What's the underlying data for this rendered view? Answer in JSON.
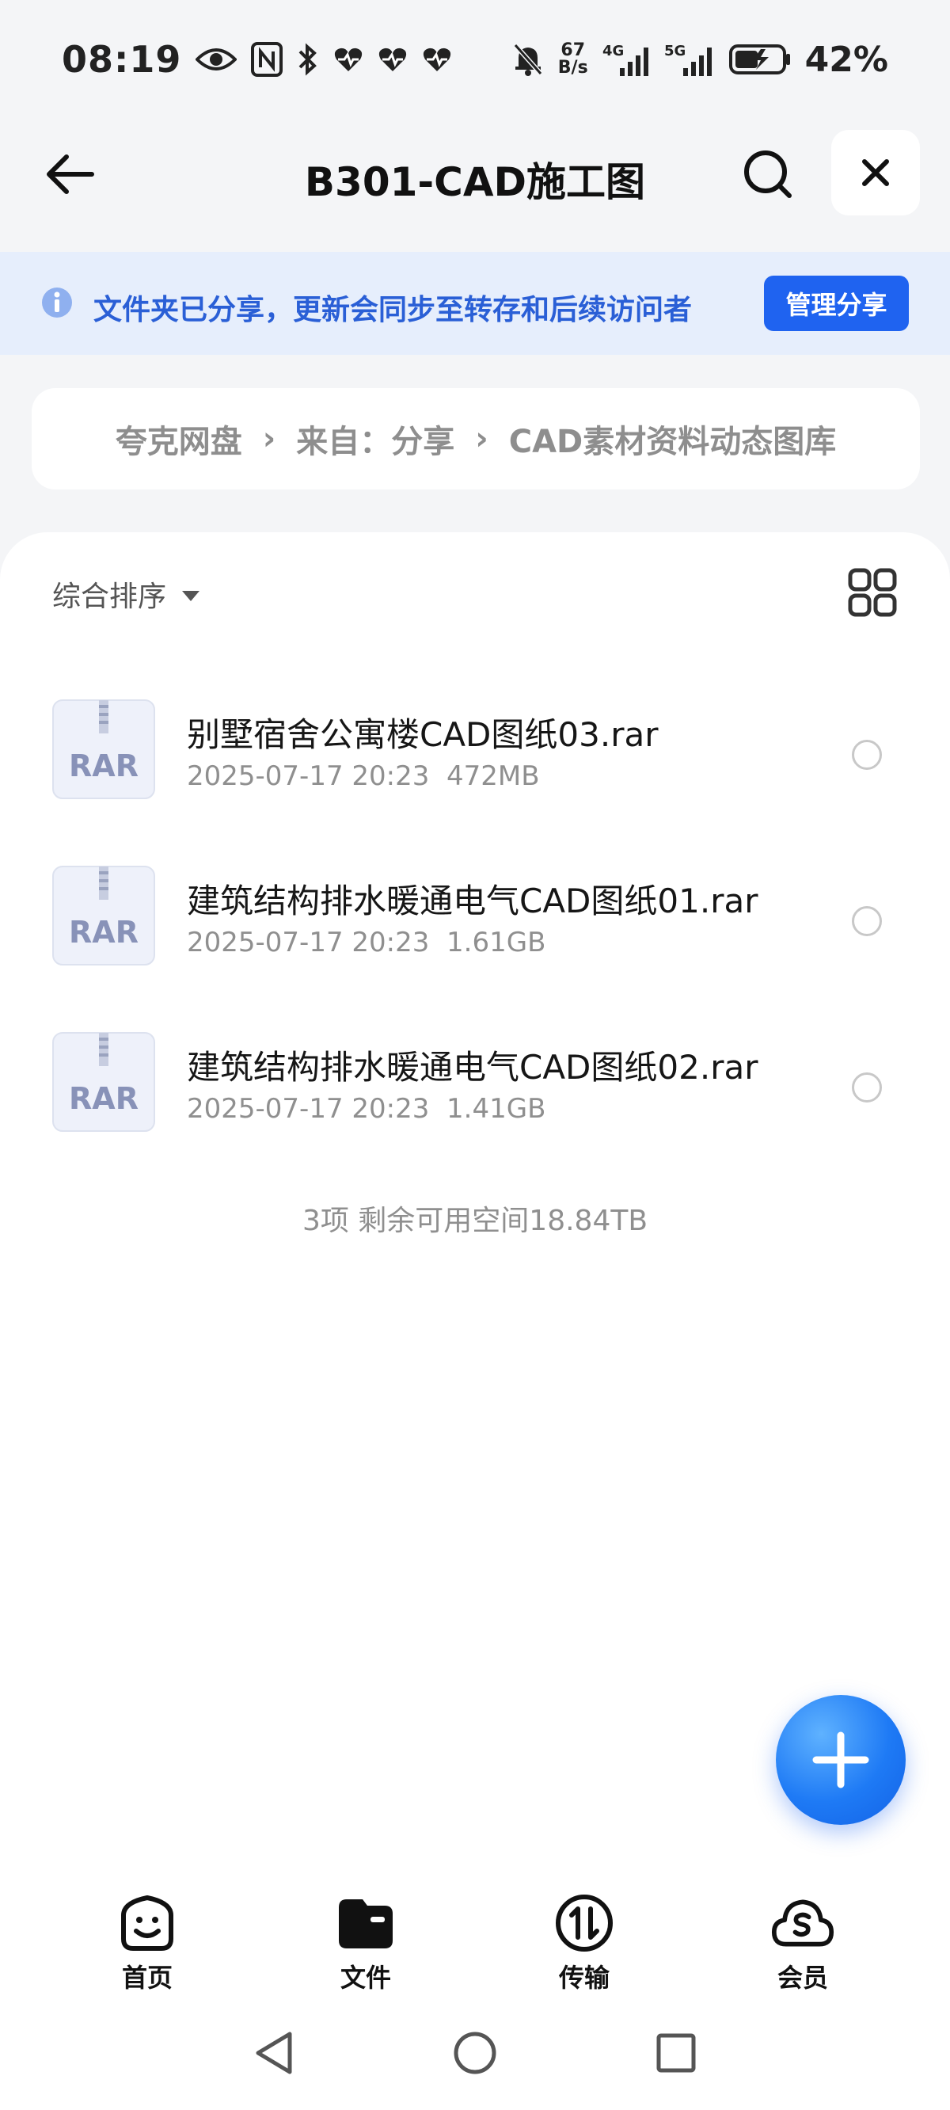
{
  "status_bar": {
    "time": "08:19",
    "net_speed_top": "67",
    "net_speed_bottom": "B/s",
    "net_4g": "4G",
    "net_5g": "5G",
    "battery": "42%"
  },
  "header": {
    "title": "B301-CAD施工图"
  },
  "notice": {
    "text": "文件夹已分享，更新会同步至转存和后续访问者",
    "button_label": "管理分享",
    "colors": {
      "background": "#e6eefc",
      "text": "#2a5fd6",
      "button": "#1f63f0"
    }
  },
  "breadcrumb": {
    "items": [
      "夸克网盘",
      "来自：分享",
      "CAD素材资料动态图库"
    ]
  },
  "toolbar": {
    "sort_label": "综合排序"
  },
  "files": [
    {
      "icon_label": "RAR",
      "name": "别墅宿舍公寓楼CAD图纸03.rar",
      "date": "2025-07-17 20:23",
      "size": "472MB"
    },
    {
      "icon_label": "RAR",
      "name": "建筑结构排水暖通电气CAD图纸01.rar",
      "date": "2025-07-17 20:23",
      "size": "1.61GB"
    },
    {
      "icon_label": "RAR",
      "name": "建筑结构排水暖通电气CAD图纸02.rar",
      "date": "2025-07-17 20:23",
      "size": "1.41GB"
    }
  ],
  "summary": "3项 剩余可用空间18.84TB",
  "bottom_nav": {
    "items": [
      {
        "label": "首页",
        "icon": "smile-home-icon"
      },
      {
        "label": "文件",
        "icon": "folder-icon"
      },
      {
        "label": "传输",
        "icon": "transfer-icon"
      },
      {
        "label": "会员",
        "icon": "cloud-member-icon"
      }
    ]
  },
  "accent_color": "#1f63f0"
}
